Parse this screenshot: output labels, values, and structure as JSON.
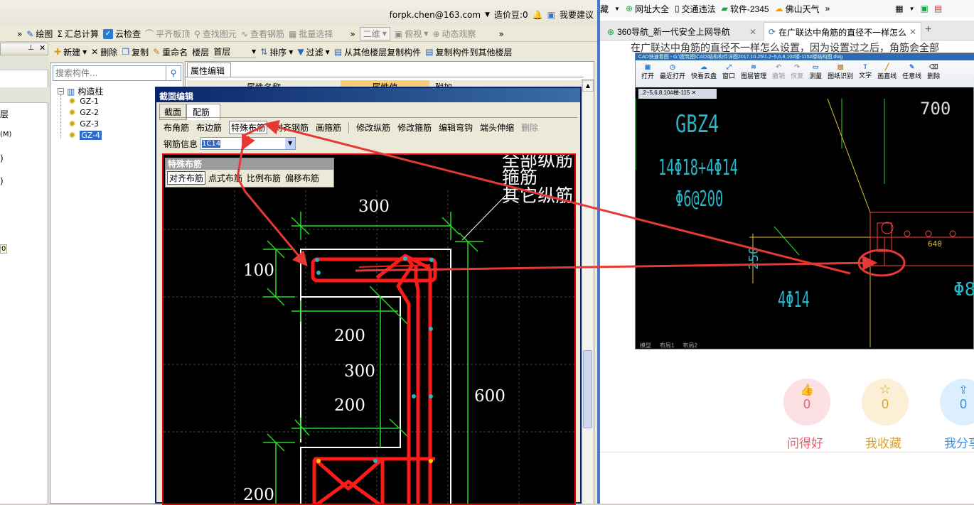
{
  "topbar": {
    "account": "forpk.chen@163.com",
    "coins": "造价豆:0",
    "suggest": "我要建议"
  },
  "toolbar1": {
    "draw": "绘图",
    "summary": "汇总计算",
    "cloud_check": "云检查",
    "level_top": "平齐板顶",
    "find": "查找图元",
    "view_rebar": "查看钢筋",
    "batch_select": "批量选择",
    "view_2d": "二维",
    "overlook": "俯视",
    "dynamic": "动态观察"
  },
  "toolbar2": {
    "new": "新建",
    "delete": "删除",
    "copy": "复制",
    "rename": "重命名",
    "floor_label": "楼层",
    "floor_value": "首层",
    "sort": "排序",
    "filter": "过滤",
    "copy_from_floor": "从其他楼层复制构件",
    "copy_to_floor": "复制构件到其他楼层"
  },
  "search": {
    "placeholder": "搜索构件..."
  },
  "tree": {
    "root": "构造柱",
    "items": [
      "GZ-1",
      "GZ-2",
      "GZ-3",
      "GZ-4"
    ]
  },
  "left_strip": {
    "labels": [
      "层",
      "(M)",
      ")",
      ")",
      "0"
    ]
  },
  "prop_tab": "属性编辑",
  "prop_headers": [
    "属性名称",
    "属性值",
    "附加"
  ],
  "dialog": {
    "title": "截面编辑",
    "tabs": [
      "截面",
      "配筋"
    ],
    "tools": [
      "布角筋",
      "布边筋",
      "特殊布筋",
      "对齐钢筋",
      "画箍筋",
      "修改纵筋",
      "修改箍筋",
      "编辑弯钩",
      "端头伸缩",
      "删除"
    ],
    "rebar_label": "钢筋信息",
    "rebar_value": "1C14",
    "special_title": "特殊布筋",
    "special_btns": [
      "对齐布筋",
      "点式布筋",
      "比例布筋",
      "偏移布筋"
    ],
    "legend": [
      "全部纵筋",
      "箍筋",
      "其它纵筋"
    ],
    "dims": [
      "300",
      "100",
      "200",
      "300",
      "200",
      "600",
      "200"
    ]
  },
  "browser": {
    "bookmarks": [
      "网址大全",
      "交通违法",
      "软件-2345",
      "佛山天气"
    ],
    "tabs": [
      "360导航_新一代安全上网导航",
      "在广联达中角筋的直径不一样怎么"
    ],
    "question": "在广联达中角筋的直径不一样怎么设置，因为设置过之后，角筋会全部",
    "cad_title": "CAD快速看图 - G:\\建筑图\\CAD\\结构构件详图2017.10.25\\1.2~5,6,8,10#楼-115#楼结构图.dwg",
    "cad_tools": [
      "打开",
      "最近打开",
      "快看云盘",
      "窗口",
      "图层管理",
      "撤销",
      "恢复",
      "测量",
      "图纸识别",
      "文字",
      "画直线",
      "任意线",
      "删除"
    ],
    "cad_file_tab": "..2~5,6,8,10#楼-115",
    "cad_texts": [
      "GBZ4",
      "14Φ18+4Φ14",
      "Φ6@200",
      "250",
      "4Φ14",
      "700",
      "640",
      "Φ8"
    ],
    "cad_bottom_tabs": [
      "模型",
      "布局1",
      "布局2"
    ],
    "actions": [
      {
        "label": "问得好",
        "count": "0"
      },
      {
        "label": "我收藏",
        "count": "0"
      },
      {
        "label": "我分享",
        "count": "0"
      }
    ]
  },
  "colors": {
    "rebar": "#ff1a1a",
    "dim": "#22dd22",
    "cad_bg": "#000000",
    "cad_text": "#27b5c8",
    "annot": "#e53935"
  }
}
